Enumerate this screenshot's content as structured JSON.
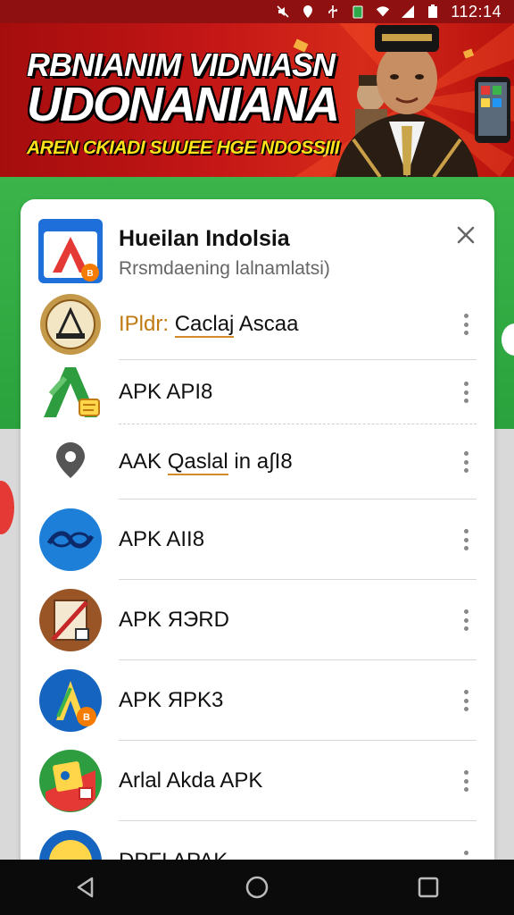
{
  "status_bar": {
    "time": "112:14",
    "icons": [
      "mute-icon",
      "location-icon",
      "usb-icon",
      "battery-saver-icon",
      "wifi-icon",
      "signal-icon",
      "battery-icon"
    ]
  },
  "banner": {
    "title_line1": "RBNIANIM VIDNIASN",
    "title_line2": "UDONANIANA",
    "tagline": "AREN CKIADI SUUEE HGE NDOSSIII",
    "colors": {
      "background": "#b8120e",
      "title": "#ffffff",
      "tagline": "#ffe21a"
    }
  },
  "dialog": {
    "title": "Hueilan Indolsia",
    "subtitle": "Rrsmdaening lalnamlatsi)",
    "close_icon": "close-icon",
    "items": [
      {
        "prefix": "IPldr: ",
        "underlined": "Caclaj",
        "suffix": " Ascaa",
        "icon": "emblem-icon"
      },
      {
        "prefix": "APK API8",
        "underlined": "",
        "suffix": "",
        "icon": "green-a-icon"
      },
      {
        "prefix": "AAK ",
        "underlined": "Qaslal",
        "suffix": " in a∫I8",
        "icon": "location-pin-icon"
      },
      {
        "prefix": "APK AII8",
        "underlined": "",
        "suffix": "",
        "icon": "blue-link-icon"
      },
      {
        "prefix": "APK ЯЭRD",
        "underlined": "",
        "suffix": "",
        "icon": "brown-pen-icon"
      },
      {
        "prefix": "APK ЯPK3",
        "underlined": "",
        "suffix": "",
        "icon": "blue-a-icon"
      },
      {
        "prefix": "Arlal Akda APK",
        "underlined": "",
        "suffix": "",
        "icon": "maps-icon"
      },
      {
        "prefix": "DPFI APAK",
        "underlined": "",
        "suffix": "",
        "icon": "badge-icon"
      }
    ]
  },
  "nav_bar": {
    "buttons": [
      "back-icon",
      "home-icon",
      "recents-icon"
    ]
  },
  "colors": {
    "accent_green": "#2aa23d",
    "accent_red": "#e53935"
  }
}
